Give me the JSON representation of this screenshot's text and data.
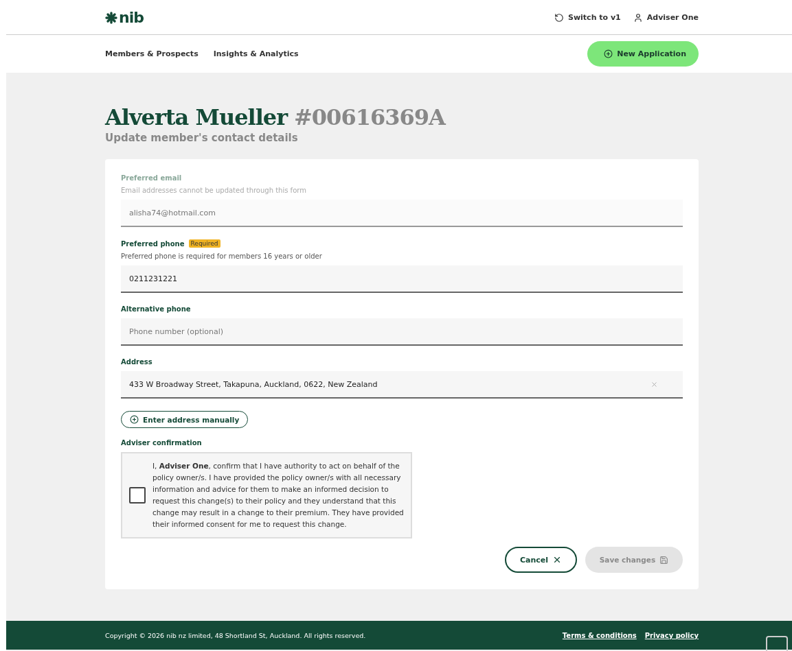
{
  "header": {
    "logo": "nib",
    "switch_link": "Switch to v1",
    "user": "Adviser One"
  },
  "nav": {
    "items": [
      {
        "label": "Members & Prospects"
      },
      {
        "label": "Insights & Analytics"
      }
    ],
    "action": "New Application"
  },
  "page": {
    "name": "Alverta Mueller",
    "member_number": "#00616369A",
    "subtitle": "Update member's contact details"
  },
  "form": {
    "fields": [
      {
        "label": "Preferred email",
        "hint": "Email addresses cannot be updated through this form",
        "value": "alisha74@hotmail.com",
        "disabled": true
      },
      {
        "label": "Preferred phone",
        "badge": "Required",
        "hint": "Preferred phone is required for members 16 years or older",
        "value": "0211231221",
        "disabled": false
      },
      {
        "label": "Alternative phone",
        "placeholder": "Phone number (optional)",
        "disabled": false
      },
      {
        "label": "Address",
        "value": "433 W Broadway Street, Takapuna, Auckland, 0622, New Zealand",
        "clearable": true,
        "disabled": false
      }
    ],
    "manual_address_button": "Enter address manually",
    "confirmation": {
      "label": "Adviser confirmation",
      "checked": false,
      "text": "I, **Adviser One**, confirm that I have authority to act on behalf of the policy owner/s. I have provided the policy owner/s with all necessary information and advice for them to make an informed decision to request this change(s) to their policy and they understand that this change may result in a change to their premium. They have provided their informed consent for me to request this change."
    },
    "cancel": "Cancel",
    "save": {
      "label": "Save changes",
      "disabled": true
    }
  },
  "footer": {
    "copyright": "Copyright © 2026 nib nz limited, 48 Shortland St, Auckland. All rights reserved.",
    "links": [
      "Terms & conditions",
      "Privacy policy"
    ]
  }
}
